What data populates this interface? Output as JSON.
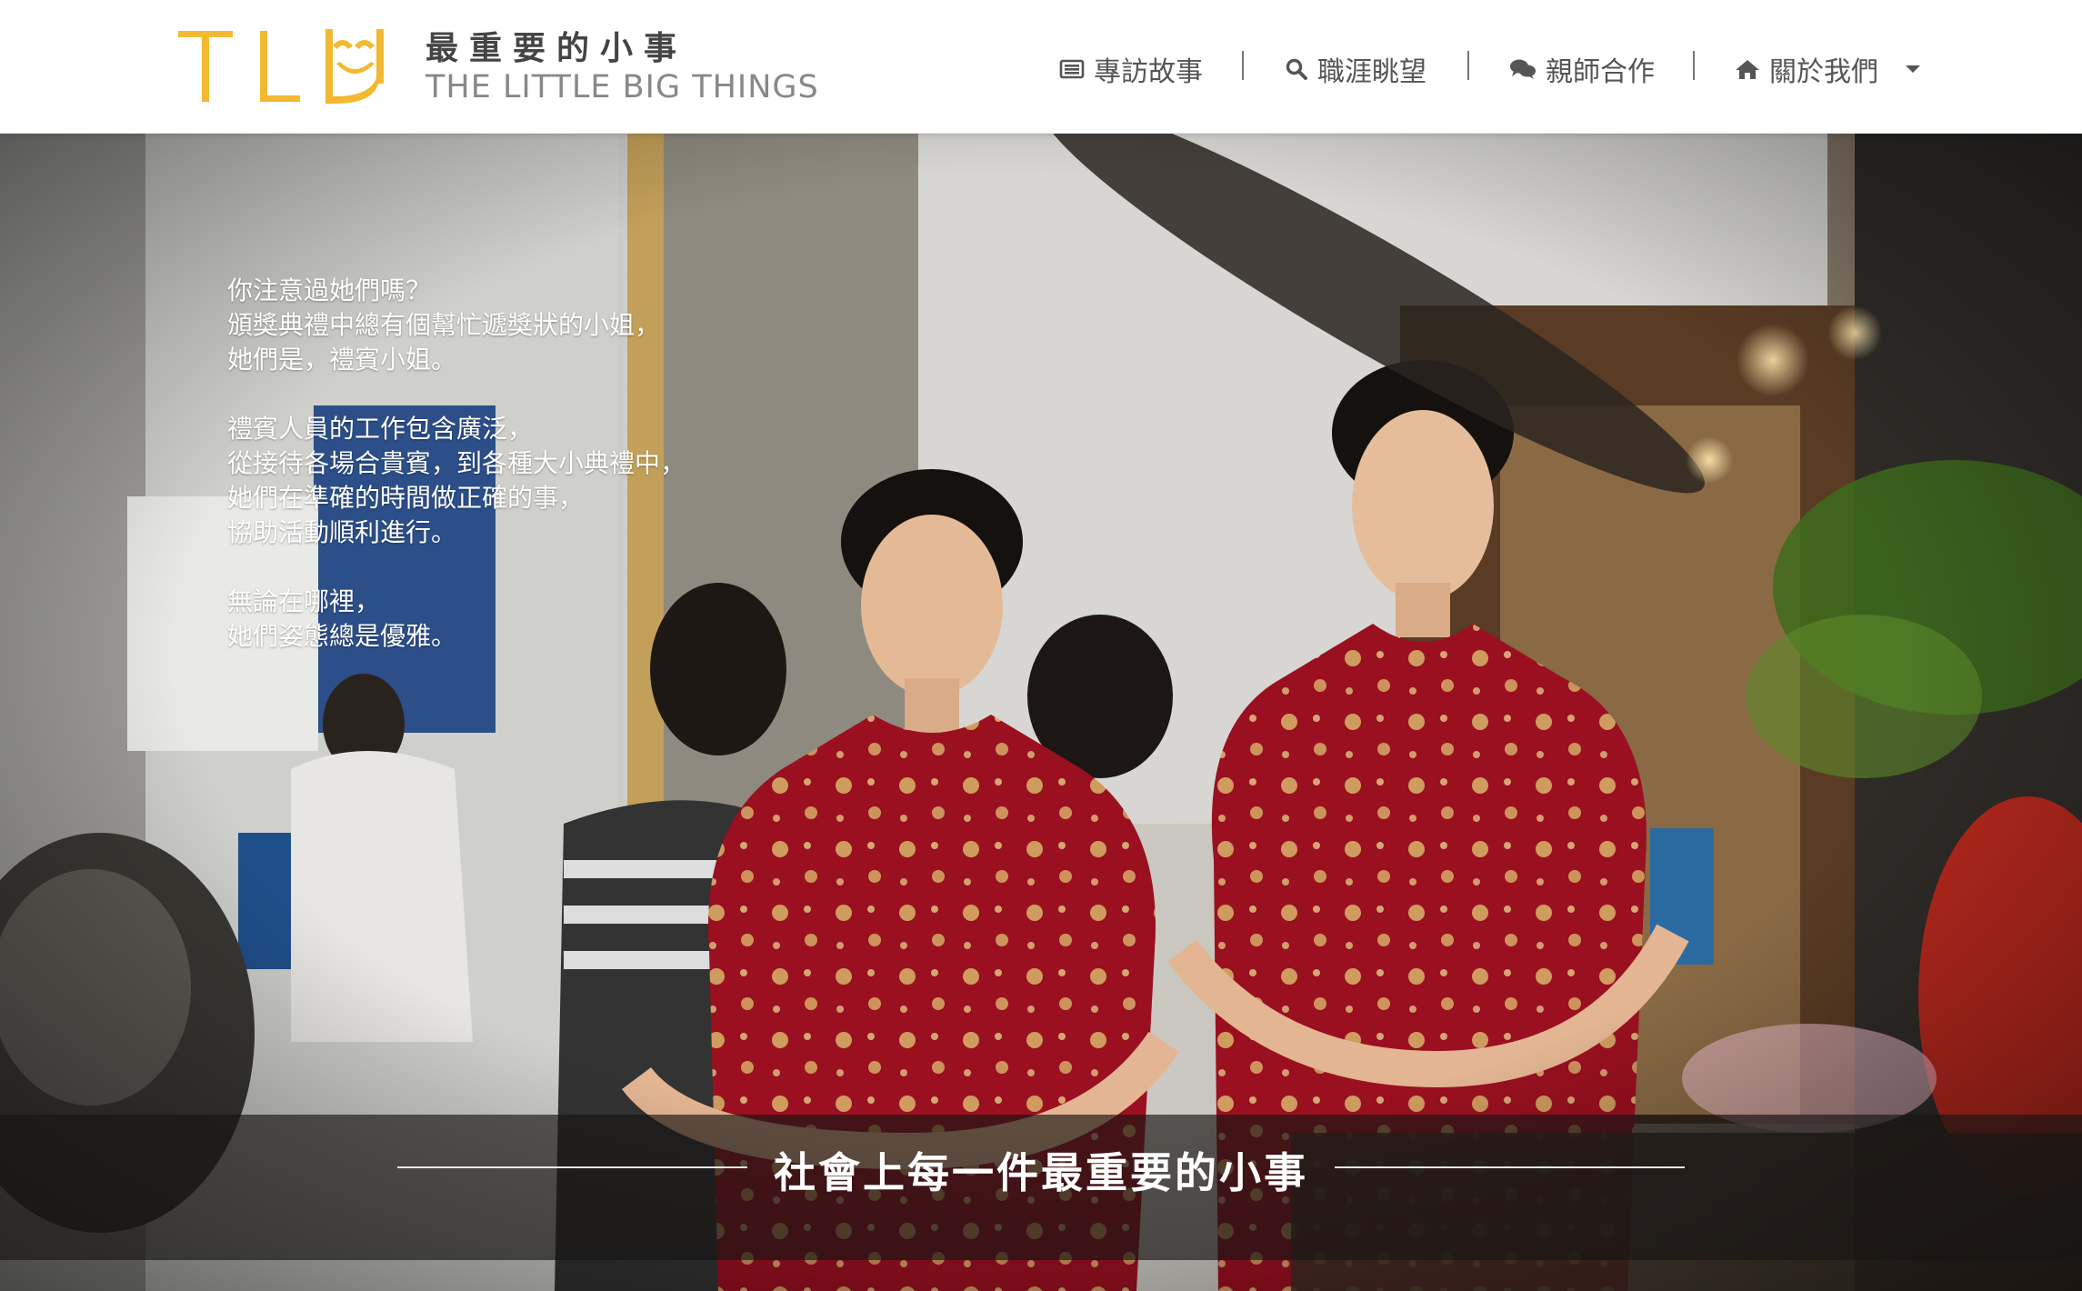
{
  "brand": {
    "cn_name": "最重要的小事",
    "en_name": "THE LITTLE BIG THINGS",
    "accent": "#f2b931"
  },
  "nav": {
    "items": [
      {
        "label": "專訪故事",
        "icon": "newspaper-icon"
      },
      {
        "label": "職涯眺望",
        "icon": "search-icon"
      },
      {
        "label": "親師合作",
        "icon": "chat-bubbles-icon"
      },
      {
        "label": "關於我們",
        "icon": "home-icon",
        "has_dropdown": true
      }
    ],
    "separator": "|"
  },
  "hero": {
    "intro_paragraphs": [
      [
        "你注意過她們嗎？",
        "頒獎典禮中總有個幫忙遞獎狀的小姐，",
        "她們是，禮賓小姐。"
      ],
      [
        "禮賓人員的工作包含廣泛，",
        "從接待各場合貴賓，到各種大小典禮中，",
        "她們在準確的時間做正確的事，",
        "協助活動順利進行。"
      ],
      [
        "無論在哪裡，",
        "她們姿態總是優雅。"
      ]
    ],
    "caption": "社會上每一件最重要的小事",
    "photo_colors": {
      "qipao_red": "#9a1020",
      "gold_pattern": "#d9b46a",
      "background_wall": "#c9c6bd"
    }
  }
}
